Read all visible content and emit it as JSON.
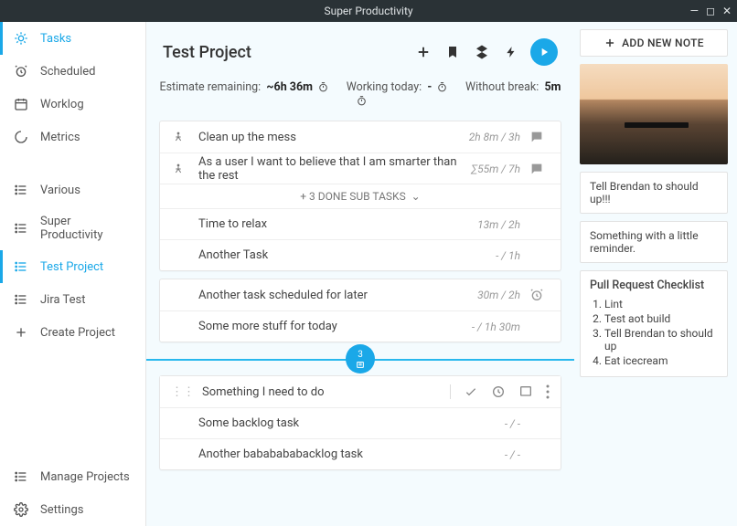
{
  "window": {
    "title": "Super Productivity"
  },
  "sidebar": {
    "top": [
      {
        "label": "Tasks",
        "icon": "sun-icon",
        "active": true
      },
      {
        "label": "Scheduled",
        "icon": "alarm-icon"
      },
      {
        "label": "Worklog",
        "icon": "calendar-icon"
      },
      {
        "label": "Metrics",
        "icon": "spinner-icon"
      }
    ],
    "projects": [
      {
        "label": "Various",
        "icon": "list-icon"
      },
      {
        "label": "Super Productivity",
        "icon": "list-icon"
      },
      {
        "label": "Test Project",
        "icon": "list-icon",
        "active": true
      },
      {
        "label": "Jira Test",
        "icon": "list-icon"
      }
    ],
    "createProject": "Create Project",
    "bottom": [
      {
        "label": "Manage Projects",
        "icon": "list-icon"
      },
      {
        "label": "Settings",
        "icon": "gear-icon"
      }
    ]
  },
  "header": {
    "title": "Test Project"
  },
  "stats": {
    "estimateLabel": "Estimate remaining:",
    "estimateValue": "~6h 36m",
    "workingLabel": "Working today:",
    "workingValue": "-",
    "breakLabel": "Without break:",
    "breakValue": "5m"
  },
  "todayTasks": [
    {
      "title": "Clean up the mess",
      "meta": "2h 8m / 3h",
      "leading": "goal",
      "trailing": "chat"
    },
    {
      "title": "As a user I want to believe that I am smarter than the rest",
      "meta": "∑55m / 7h",
      "leading": "goal",
      "trailing": "chat"
    }
  ],
  "doneSubTasksLabel": "+ 3 DONE SUB TASKS",
  "subTasks": [
    {
      "title": "Time to relax",
      "meta": "13m / 2h"
    },
    {
      "title": "Another Task",
      "meta": "- / 1h"
    }
  ],
  "scheduledTasks": [
    {
      "title": "Another task scheduled for later",
      "meta": "30m / 2h",
      "trailing": "alarm"
    },
    {
      "title": "Some more stuff for today",
      "meta": "- / 1h 30m"
    }
  ],
  "divider": {
    "count": "3"
  },
  "backlog": [
    {
      "title": "Something I need to do",
      "hover": true
    },
    {
      "title": "Some backlog task",
      "meta": "- / -"
    },
    {
      "title": "Another bababababacklog task",
      "meta": "- / -"
    }
  ],
  "notes": {
    "add": "ADD NEW NOTE",
    "items": [
      {
        "type": "image"
      },
      {
        "type": "text",
        "text": "Tell Brendan to should up!!!"
      },
      {
        "type": "text",
        "text": "Something with a little reminder."
      },
      {
        "type": "checklist",
        "title": "Pull Request Checklist",
        "items": [
          "Lint",
          "Test aot build",
          "Tell Brendan to should up",
          "Eat icecream"
        ]
      }
    ]
  }
}
